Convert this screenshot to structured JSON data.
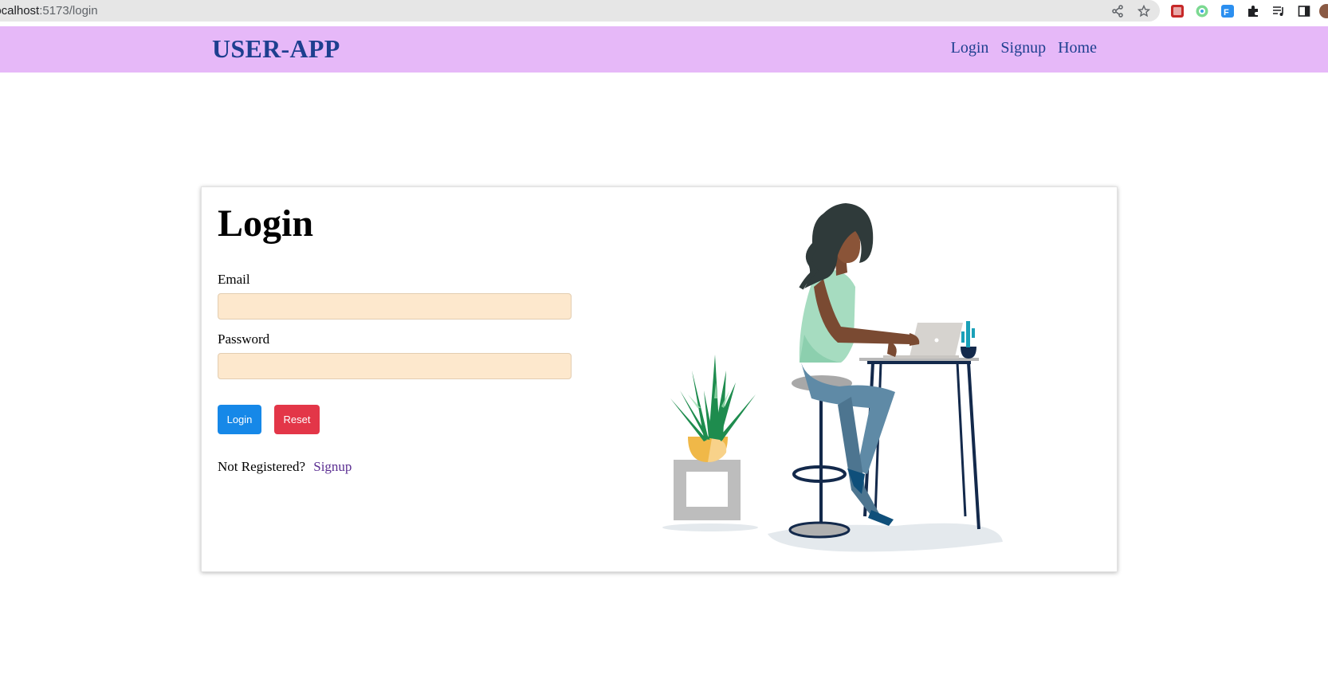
{
  "browser": {
    "url_host": "localhost",
    "url_path": ":5173/login",
    "icons": [
      "share-icon",
      "star-icon",
      "extension-icon",
      "extension-icon",
      "extension-icon",
      "puzzle-icon",
      "media-icon",
      "sidebar-icon"
    ]
  },
  "navbar": {
    "brand": "USER-APP",
    "links": [
      "Login",
      "Signup",
      "Home"
    ]
  },
  "form": {
    "title": "Login",
    "email_label": "Email",
    "email_value": "",
    "password_label": "Password",
    "password_value": "",
    "login_button": "Login",
    "reset_button": "Reset",
    "not_registered": "Not Registered?",
    "signup_link": "Signup"
  },
  "colors": {
    "navbar_bg": "#e6b8f8",
    "brand": "#1d3f8f",
    "input_bg": "#fde8cd",
    "login_button": "#1688e8",
    "reset_button": "#e33648"
  }
}
